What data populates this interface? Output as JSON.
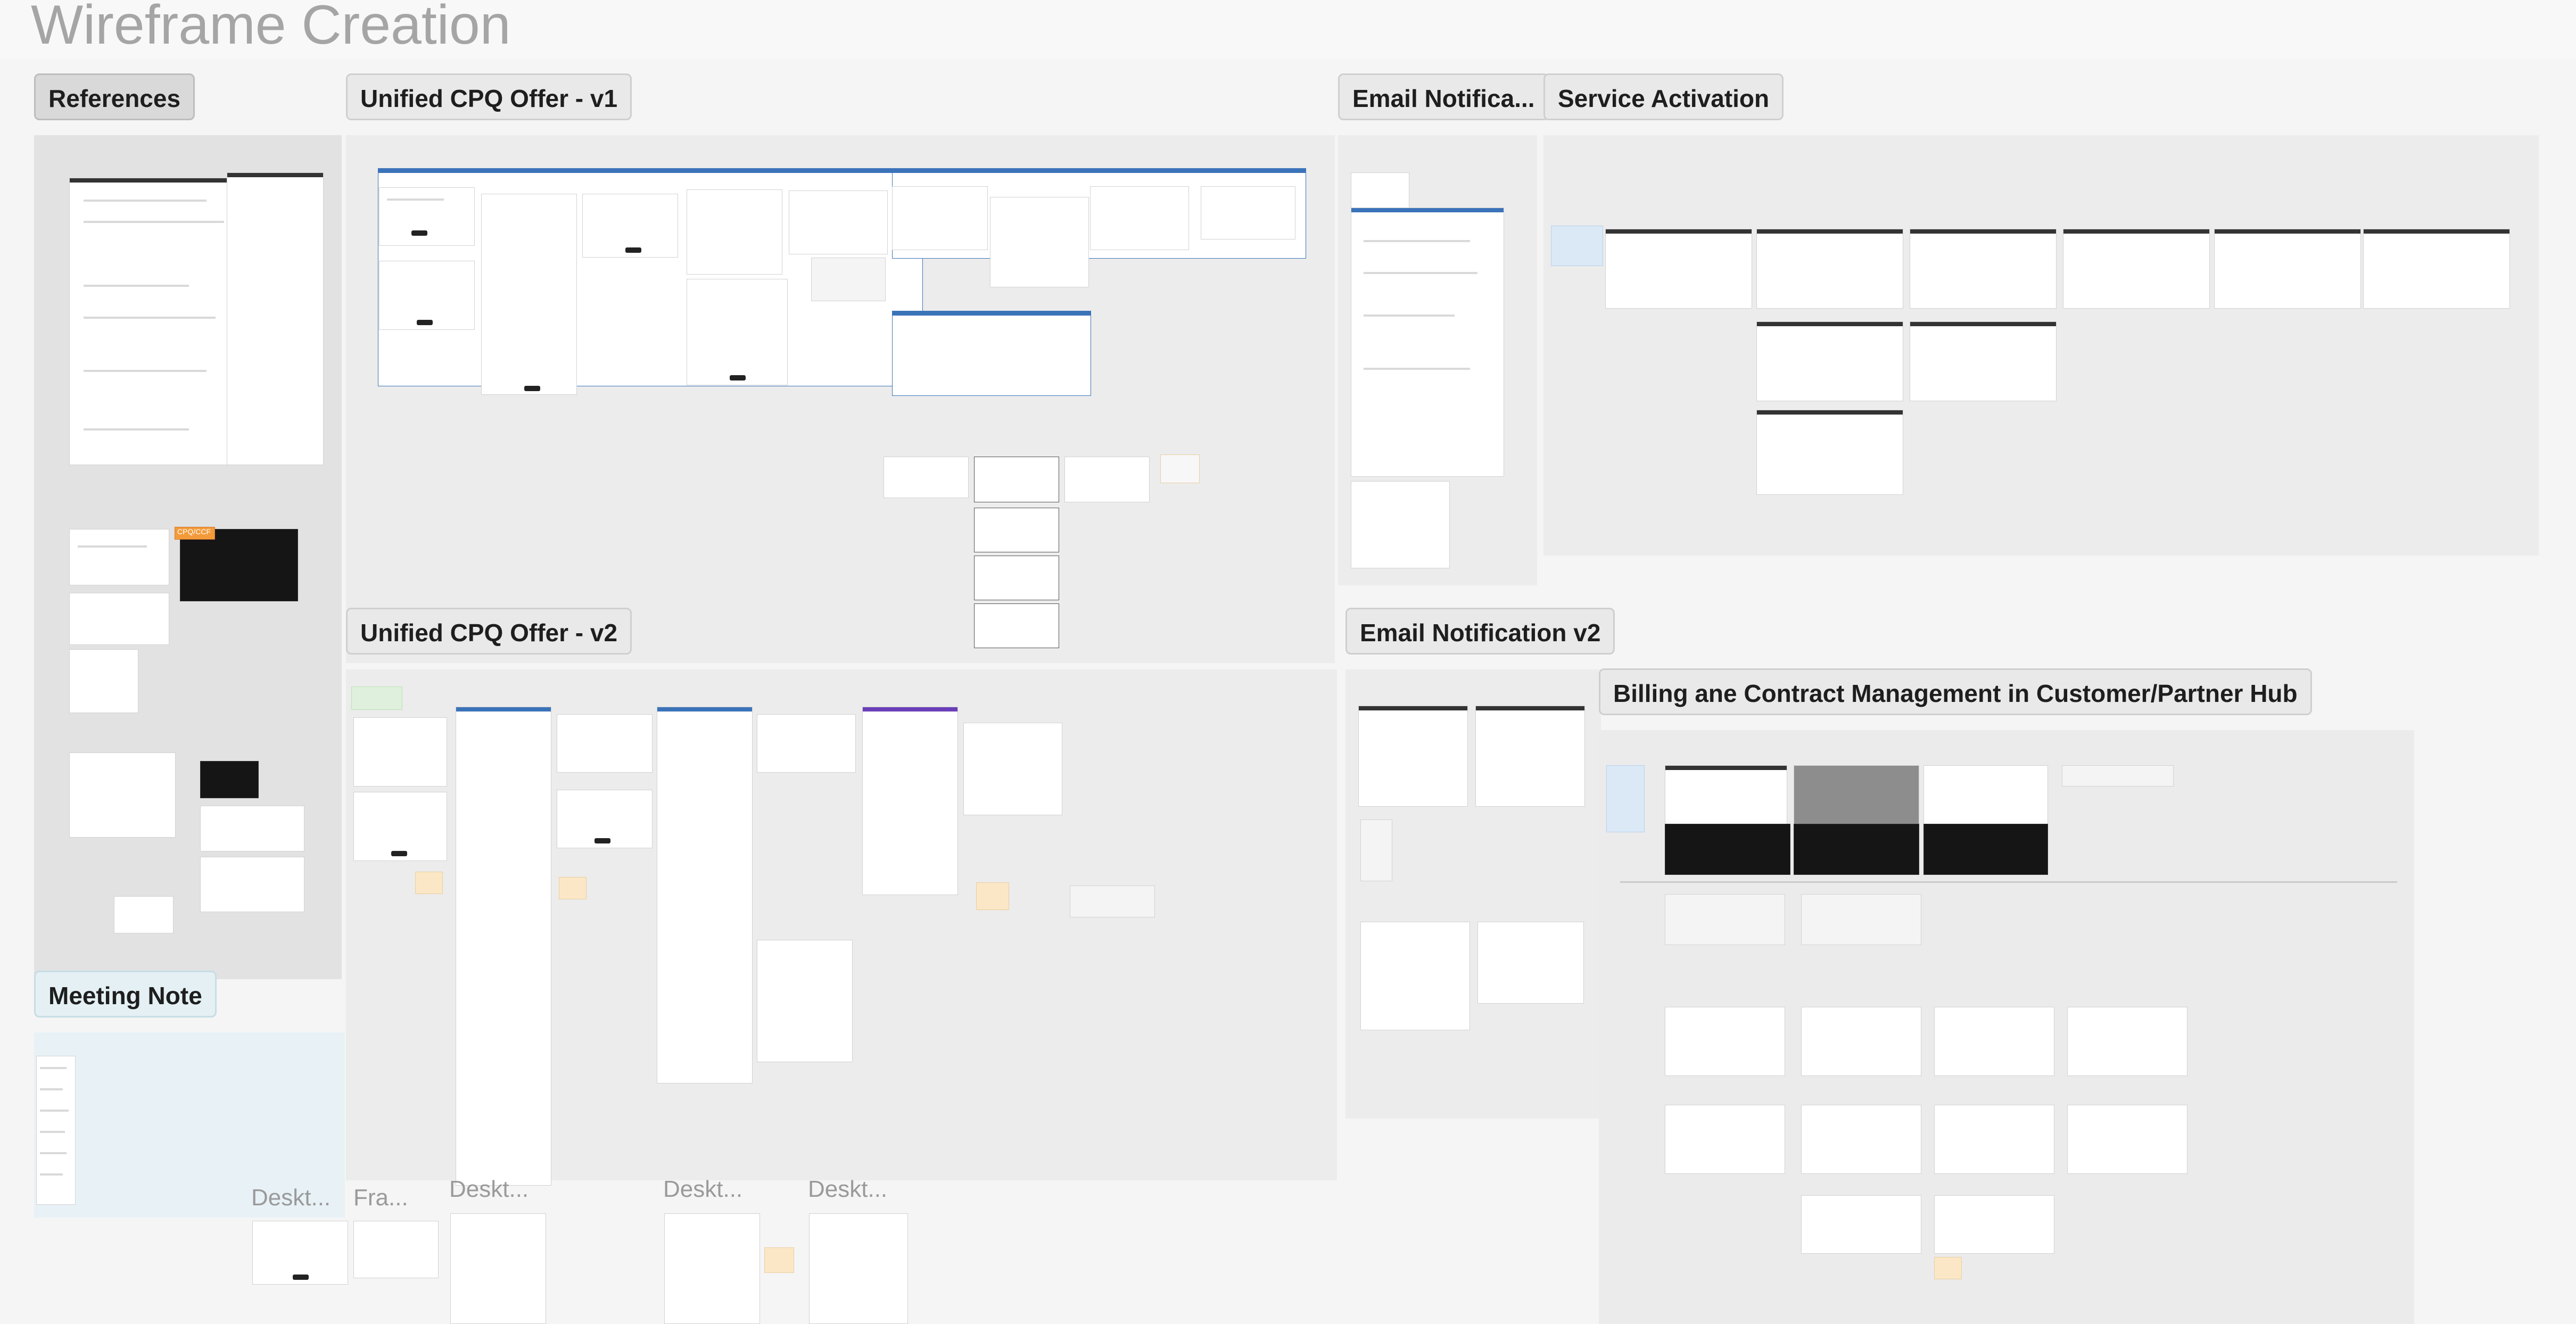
{
  "page": {
    "title": "Wireframe Creation"
  },
  "sections": {
    "references": "References",
    "cpq_v1": "Unified CPQ Offer - v1",
    "email_notification": "Email Notifica...",
    "service_activation": "Service Activation",
    "cpq_v2": "Unified CPQ Offer - v2",
    "email_notification_v2": "Email Notification v2",
    "billing": "Billing ane Contract Management in Customer/Partner Hub",
    "meeting_note": "Meeting Note"
  },
  "loose_frames": {
    "desktop_1": "Deskt...",
    "frame_1": "Fra...",
    "desktop_2": "Deskt...",
    "desktop_3": "Deskt...",
    "desktop_4": "Deskt..."
  },
  "references": {
    "badge": "CPQ/CCF"
  },
  "colors": {
    "canvas": "#f5f5f5",
    "section": "#ececec",
    "accent_blue": "#3b73b9",
    "accent_purple": "#6a3fb8",
    "sticky_yellow": "#fbe7c6",
    "sticky_orange": "#f39a3a"
  }
}
